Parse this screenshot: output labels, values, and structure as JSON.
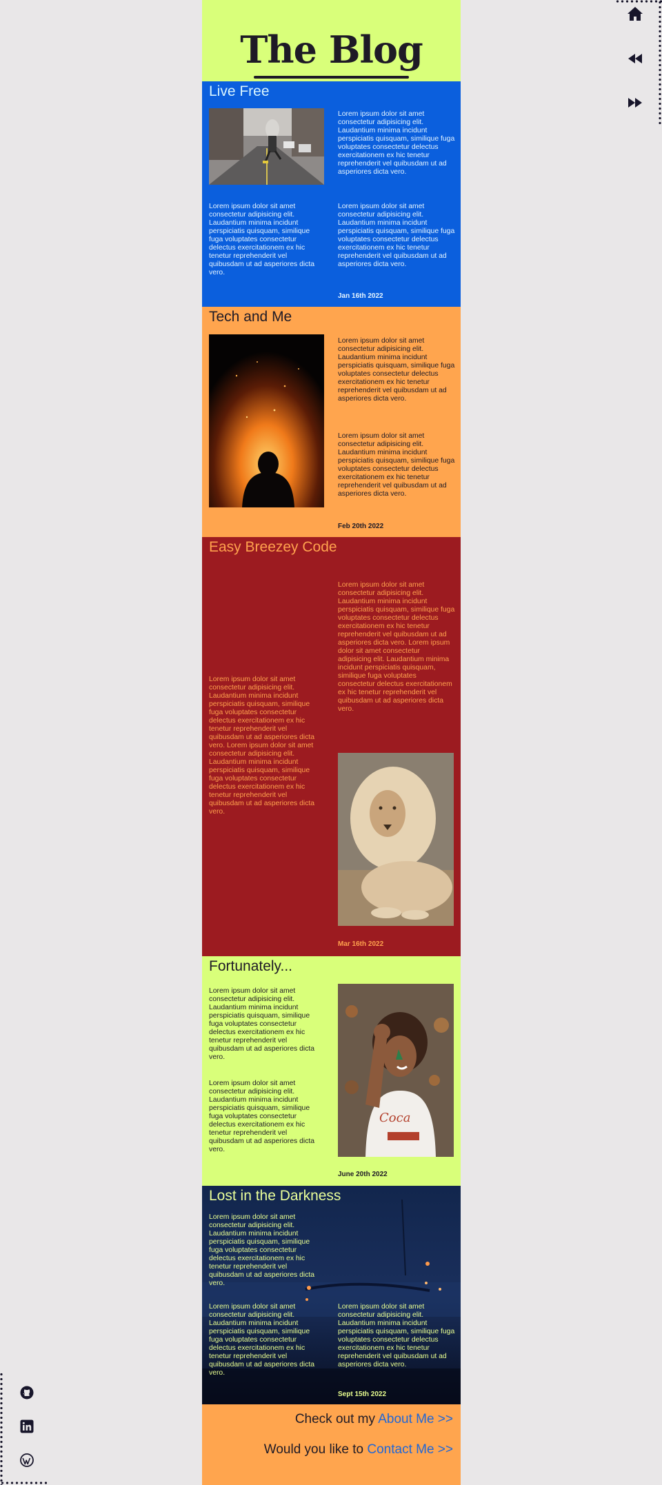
{
  "header": {
    "title": "The Blog"
  },
  "nav": {
    "home_icon": "home-icon",
    "back_icon": "rewind-icon",
    "forward_icon": "fast-forward-icon"
  },
  "social": {
    "github_icon": "github-icon",
    "linkedin_icon": "linkedin-icon",
    "wordpress_icon": "wordpress-icon"
  },
  "posts": [
    {
      "title": "Live Free",
      "date": "Jan 16th 2022",
      "paragraphs": [
        "Lorem ipsum dolor sit amet consectetur adipisicing elit. Laudantium minima incidunt perspiciatis quisquam, similique fuga voluptates consectetur delectus exercitationem ex hic tenetur reprehenderit vel quibusdam ut ad asperiores dicta vero.",
        "Lorem ipsum dolor sit amet consectetur adipisicing elit. Laudantium minima incidunt perspiciatis quisquam, similique fuga voluptates consectetur delectus exercitationem ex hic tenetur reprehenderit vel quibusdam ut ad asperiores dicta vero.",
        "Lorem ipsum dolor sit amet consectetur adipisicing elit. Laudantium minima incidunt perspiciatis quisquam, similique fuga voluptates consectetur delectus exercitationem ex hic tenetur reprehenderit vel quibusdam ut ad asperiores dicta vero."
      ]
    },
    {
      "title": "Tech and Me",
      "date": "Feb 20th 2022",
      "paragraphs": [
        "Lorem ipsum dolor sit amet consectetur adipisicing elit. Laudantium minima incidunt perspiciatis quisquam, similique fuga voluptates consectetur delectus exercitationem ex hic tenetur reprehenderit vel quibusdam ut ad asperiores dicta vero.",
        "Lorem ipsum dolor sit amet consectetur adipisicing elit. Laudantium minima incidunt perspiciatis quisquam, similique fuga voluptates consectetur delectus exercitationem ex hic tenetur reprehenderit vel quibusdam ut ad asperiores dicta vero."
      ]
    },
    {
      "title": "Easy Breezey Code",
      "date": "Mar 16th 2022",
      "paragraphs": [
        "Lorem ipsum dolor sit amet consectetur adipisicing elit. Laudantium minima incidunt perspiciatis quisquam, similique fuga voluptates consectetur delectus exercitationem ex hic tenetur reprehenderit vel quibusdam ut ad asperiores dicta vero. Lorem ipsum dolor sit amet consectetur adipisicing elit. Laudantium minima incidunt perspiciatis quisquam, similique fuga voluptates consectetur delectus exercitationem ex hic tenetur reprehenderit vel quibusdam ut ad asperiores dicta vero.",
        "Lorem ipsum dolor sit amet consectetur adipisicing elit. Laudantium minima incidunt perspiciatis quisquam, similique fuga voluptates consectetur delectus exercitationem ex hic tenetur reprehenderit vel quibusdam ut ad asperiores dicta vero. Lorem ipsum dolor sit amet consectetur adipisicing elit. Laudantium minima incidunt perspiciatis quisquam, similique fuga voluptates consectetur delectus exercitationem ex hic tenetur reprehenderit vel quibusdam ut ad asperiores dicta vero."
      ]
    },
    {
      "title": "Fortunately...",
      "date": "June 20th 2022",
      "paragraphs": [
        "Lorem ipsum dolor sit amet consectetur adipisicing elit. Laudantium minima incidunt perspiciatis quisquam, similique fuga voluptates consectetur delectus exercitationem ex hic tenetur reprehenderit vel quibusdam ut ad asperiores dicta vero.",
        "Lorem ipsum dolor sit amet consectetur adipisicing elit. Laudantium minima incidunt perspiciatis quisquam, similique fuga voluptates consectetur delectus exercitationem ex hic tenetur reprehenderit vel quibusdam ut ad asperiores dicta vero."
      ]
    },
    {
      "title": "Lost in the Darkness",
      "date": "Sept 15th 2022",
      "paragraphs": [
        "Lorem ipsum dolor sit amet consectetur adipisicing elit. Laudantium minima incidunt perspiciatis quisquam, similique fuga voluptates consectetur delectus exercitationem ex hic tenetur reprehenderit vel quibusdam ut ad asperiores dicta vero.",
        "Lorem ipsum dolor sit amet consectetur adipisicing elit. Laudantium minima incidunt perspiciatis quisquam, similique fuga voluptates consectetur delectus exercitationem ex hic tenetur reprehenderit vel quibusdam ut ad asperiores dicta vero.",
        "Lorem ipsum dolor sit amet consectetur adipisicing elit. Laudantium minima incidunt perspiciatis quisquam, similique fuga voluptates consectetur delectus exercitationem ex hic tenetur reprehenderit vel quibusdam ut ad asperiores dicta vero."
      ]
    }
  ],
  "footer": {
    "about_prefix": "Check out my ",
    "about_link": "About Me >>",
    "contact_prefix": "Would you like to ",
    "contact_link": "Contact Me >>"
  },
  "colors": {
    "page_bg": "#e9e7e8",
    "lime": "#d9ff7a",
    "blue": "#0b5fdd",
    "orange": "#ffa54e",
    "crimson": "#9c1b20",
    "navy": "#0e2046",
    "ink": "#1e1a26",
    "link": "#1f67d8"
  }
}
